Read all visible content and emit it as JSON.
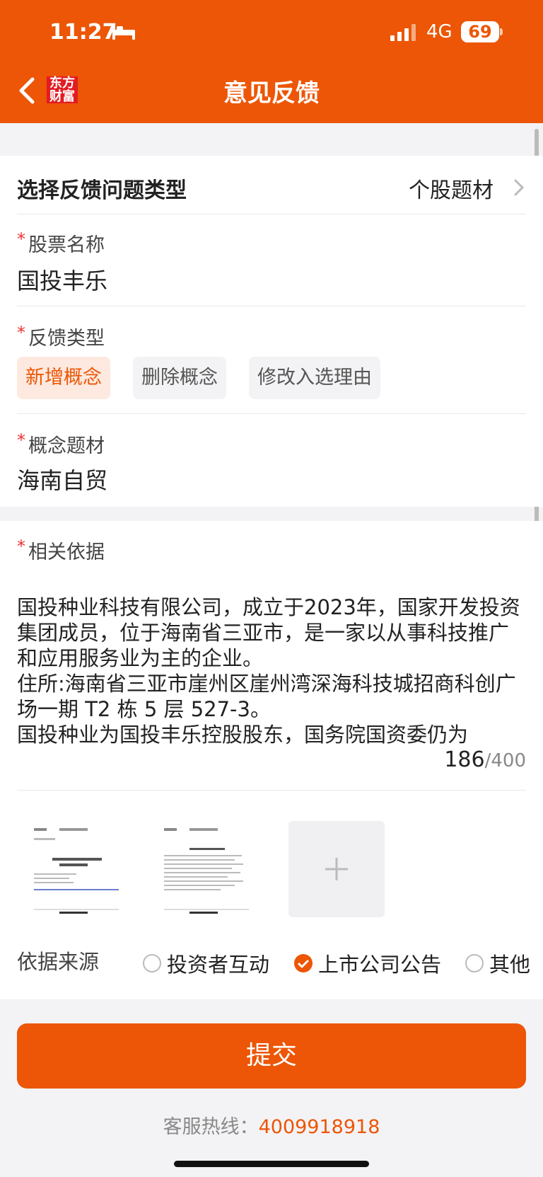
{
  "status": {
    "time": "11:27",
    "network": "4G",
    "battery": "69"
  },
  "header": {
    "title": "意见反馈",
    "logo_line1": "东方",
    "logo_line2": "财富"
  },
  "feedback_type": {
    "label": "选择反馈问题类型",
    "value": "个股题材"
  },
  "stock": {
    "label": "股票名称",
    "value": "国投丰乐"
  },
  "category": {
    "label": "反馈类型",
    "options": [
      {
        "label": "新增概念",
        "selected": true
      },
      {
        "label": "删除概念",
        "selected": false
      },
      {
        "label": "修改入选理由",
        "selected": false
      }
    ]
  },
  "concept": {
    "label": "概念题材",
    "value": "海南自贸"
  },
  "basis": {
    "label": "相关依据",
    "text_lines": [
      "国投种业科技有限公司，成立于2023年，国家开发投资集团成员，位于海南省三亚市，是一家以从事科技推广和应用服务业为主的企业。",
      "住所:海南省三亚市崖州区崖州湾深海科技城招商科创广场一期 T2 栋 5 层 527-3。",
      "国投种业为国投丰乐控股股东，国务院国资委仍为"
    ],
    "count": "186",
    "max": "/400"
  },
  "source": {
    "label": "依据来源",
    "options": [
      {
        "label": "投资者互动",
        "selected": false
      },
      {
        "label": "上市公司公告",
        "selected": true
      },
      {
        "label": "其他",
        "selected": false
      }
    ]
  },
  "submit_label": "提交",
  "hotline": {
    "label": "客服热线：",
    "number": "4009918918"
  },
  "colors": {
    "accent": "#ec5606"
  }
}
